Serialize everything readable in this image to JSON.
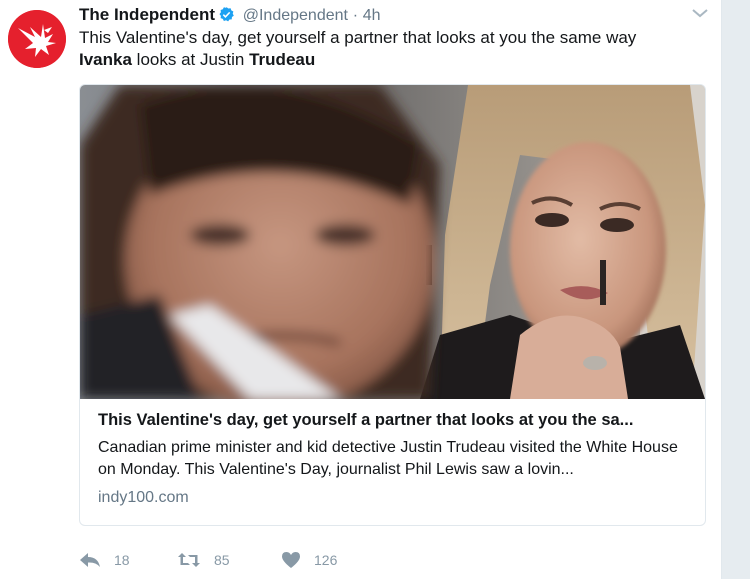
{
  "tweet": {
    "author_name": "The Independent",
    "handle": "@Independent",
    "separator": "·",
    "time": "4h",
    "text_line1": "This Valentine's day, get yourself a partner that looks at you the same way",
    "text_bold1": "Ivanka",
    "text_mid": " looks at Justin ",
    "text_bold2": "Trudeau"
  },
  "card": {
    "title": "This Valentine's day, get yourself a partner that looks at you the sa...",
    "description": "Canadian prime minister and kid detective Justin Trudeau visited the White House on Monday. This Valentine's Day, journalist Phil Lewis saw a lovin...",
    "domain": "indy100.com"
  },
  "actions": {
    "reply_count": "18",
    "retweet_count": "85",
    "like_count": "126"
  },
  "colors": {
    "brand_red": "#e5202d",
    "verified_blue": "#1da1f2",
    "muted_text": "#657786",
    "action_gray": "#8899a6"
  },
  "icons": [
    "eagle-logo-icon",
    "verified-badge-icon",
    "chevron-down-icon",
    "reply-icon",
    "retweet-icon",
    "heart-icon"
  ]
}
